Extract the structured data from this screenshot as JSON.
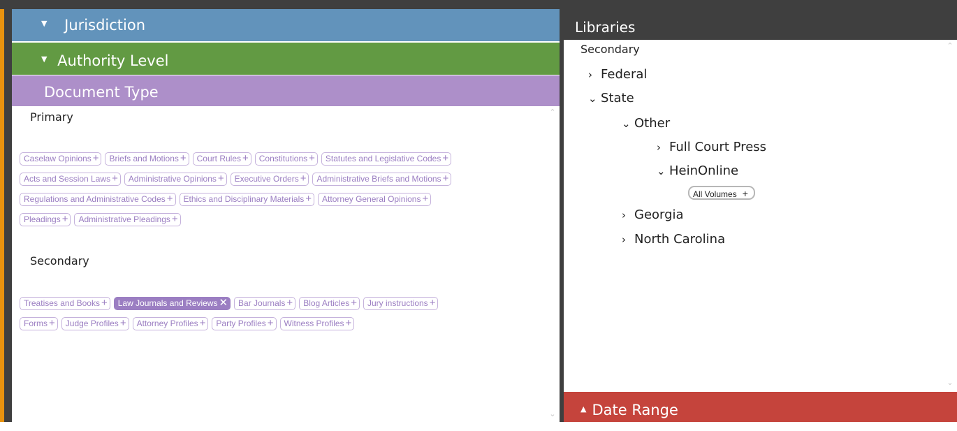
{
  "left": {
    "jurisdiction": {
      "arrow": "▼",
      "label": "Jurisdiction"
    },
    "authority": {
      "arrow": "▼",
      "label": "Authority Level"
    },
    "document_type": {
      "label": "Document Type"
    },
    "primary": {
      "title": "Primary",
      "rows": [
        [
          "Caselaw Opinions",
          "Briefs and Motions",
          "Court Rules",
          "Constitutions",
          "Statutes and Legislative Codes"
        ],
        [
          "Acts and Session Laws",
          "Administrative Opinions",
          "Executive Orders",
          "Administrative Briefs and Motions"
        ],
        [
          "Regulations and Administrative Codes",
          "Ethics and Disciplinary Materials",
          "Attorney General Opinions"
        ],
        [
          "Pleadings",
          "Administrative Pleadings"
        ]
      ]
    },
    "secondary": {
      "title": "Secondary",
      "selected": "Law Journals and Reviews",
      "rows": [
        [
          "Treatises and Books",
          "Law Journals and Reviews",
          "Bar Journals",
          "Blog Articles",
          "Jury instructions"
        ],
        [
          "Forms",
          "Judge Profiles",
          "Attorney Profiles",
          "Party Profiles",
          "Witness Profiles"
        ]
      ]
    },
    "chip_plus": "+",
    "chip_remove": "✕",
    "scroll_up": "⌃",
    "scroll_down": "⌄"
  },
  "right": {
    "header": "Libraries",
    "section": "Secondary",
    "tree": {
      "federal": "Federal",
      "state": "State",
      "other": "Other",
      "full_court_press": "Full Court Press",
      "heinonline": "HeinOnline",
      "all_volumes": "All Volumes",
      "georgia": "Georgia",
      "north_carolina": "North Carolina"
    },
    "chev_right": "›",
    "chev_down": "⌄",
    "plus": "+",
    "date_range": {
      "arrow": "▲",
      "label": "Date Range"
    },
    "scroll_up": "⌃",
    "scroll_down": "⌄"
  },
  "colors": {
    "jurisdiction": "#6293bb",
    "authority": "#629a43",
    "document_type": "#ad8fc9",
    "date_range": "#c5443c",
    "chip_text": "#9b7ec2",
    "accent": "#e8920e"
  }
}
